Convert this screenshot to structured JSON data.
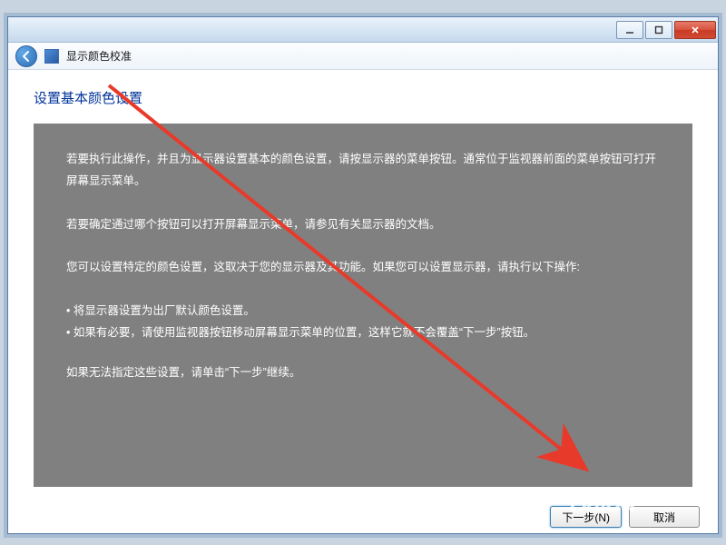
{
  "window": {
    "app_title": "显示颜色校准"
  },
  "page": {
    "heading": "设置基本颜色设置",
    "para1": "若要执行此操作，并且为显示器设置基本的颜色设置，请按显示器的菜单按钮。通常位于监视器前面的菜单按钮可打开屏幕显示菜单。",
    "para2": "若要确定通过哪个按钮可以打开屏幕显示菜单，请参见有关显示器的文档。",
    "para3": "您可以设置特定的颜色设置，这取决于您的显示器及其功能。如果您可以设置显示器，请执行以下操作:",
    "bullet1": "将显示器设置为出厂默认颜色设置。",
    "bullet2": "如果有必要，请使用监视器按钮移动屏幕显示菜单的位置，这样它就不会覆盖“下一步”按钮。",
    "para4": "如果无法指定这些设置，请单击“下一步”继续。"
  },
  "buttons": {
    "next": "下一步(N)",
    "cancel": "取消"
  },
  "watermark": "Baidu"
}
